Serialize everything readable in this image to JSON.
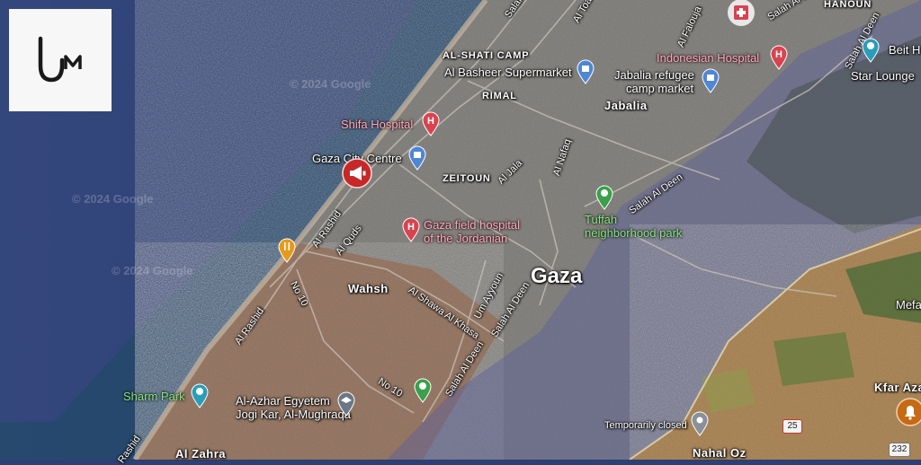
{
  "logo": {
    "icon": "um-logo"
  },
  "watermarks": [
    "© 2024 Google",
    "© 2024 Google",
    "© 2024 Google"
  ],
  "places": {
    "al_shati_camp": "AL-SHATI CAMP",
    "rimal": "RIMAL",
    "zeitoun": "ZEITOUN",
    "jabalia": "Jabalia",
    "gaza": "Gaza",
    "wahsh": "Wahsh",
    "nahal_oz": "Nahal Oz",
    "kfar_aza": "Kfar Aza",
    "al_zahra": "Al Zahra",
    "hanoun": "HANOUN",
    "beit": "Beit H",
    "mefa": "Mefa"
  },
  "pois": {
    "shifa": "Shifa Hospital",
    "gaza_city_centre": "Gaza City Centre",
    "field_hospital_1": "Gaza field hospital",
    "field_hospital_2": "of the Jordanian",
    "al_basheer": "Al Basheer Supermarket",
    "jabalia_market_1": "Jabalia refugee",
    "jabalia_market_2": "camp market",
    "indonesian": "Indonesian Hospital",
    "tuffah_1": "Tuffah",
    "tuffah_2": "neighborhood park",
    "sharm_park": "Sharm Park",
    "al_azhar": "Al-Azhar Egyetem",
    "jogi_kar": "Jogi Kar, Al-Mughraqa",
    "temporarily_closed": "Temporarily closed",
    "star_lounge": "Star Lounge"
  },
  "roads": {
    "salah_khalaf": "Salah Khalaf",
    "al_toam": "Al Toam",
    "al_falouja": "Al Falouja",
    "al_jala": "Al Jala",
    "al_nafaq": "Al Nafaq",
    "al_rashid_1": "Al Rashid",
    "al_quds": "Al Quds",
    "al_rashid_2": "Al Rashid",
    "al_rashid_3": "Rashid",
    "no10_a": "No 10",
    "no10_b": "No 10",
    "al_shawa": "Al Shawa Al Khasa",
    "um_ayyoun": "Um Ayyoun",
    "salah_deen_1": "Salah Al Deen",
    "salah_deen_2": "Salah Al Deen",
    "salah_deen_3": "Salah Al Deen",
    "salah_deen_4": "Salah Al Deen",
    "salah_deen_5": "Salah Al Deen",
    "route_25": "25",
    "route_232": "232"
  },
  "colors": {
    "sea": "#2d3f73",
    "urban": "#8f8d88",
    "desert": "#a8856a",
    "overlay": "#5a5f9e",
    "hospital_pin": "#d9434f",
    "shop_pin": "#4f86d6",
    "park_pin": "#3aa04a",
    "alert_pin": "#c62828",
    "food_pin": "#e59a1a",
    "bell_pin": "#c66a13"
  }
}
